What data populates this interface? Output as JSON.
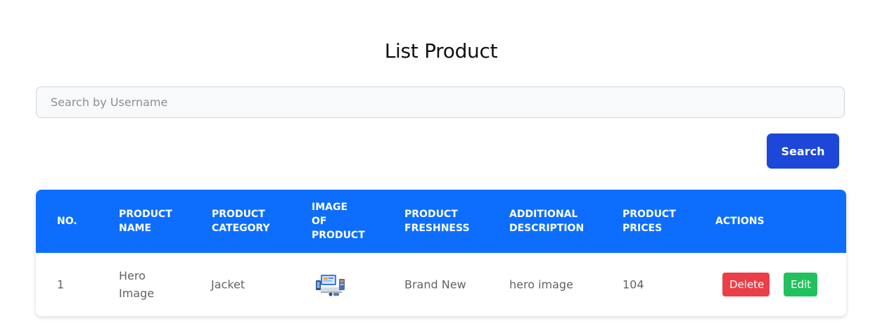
{
  "page": {
    "title": "List Product"
  },
  "search": {
    "placeholder": "Search by Username",
    "value": "",
    "button_label": "Search"
  },
  "table": {
    "columns": [
      "NO.",
      "PRODUCT\nNAME",
      "PRODUCT\nCATEGORY",
      "IMAGE\nOF\nPRODUCT",
      "PRODUCT\nFRESHNESS",
      "ADDITIONAL\nDESCRIPTION",
      "PRODUCT\nPRICES",
      "ACTIONS"
    ],
    "rows": [
      {
        "no": "1",
        "name": "Hero\nImage",
        "category": "Jacket",
        "image_icon": "hero-illustration-icon",
        "freshness": "Brand New",
        "description": "hero image",
        "price": "104",
        "delete_label": "Delete",
        "edit_label": "Edit"
      }
    ]
  },
  "colors": {
    "header_bg": "#0d6efd",
    "search_button": "#1c47d8",
    "delete_button": "#ea3f48",
    "edit_button": "#22c15e"
  }
}
